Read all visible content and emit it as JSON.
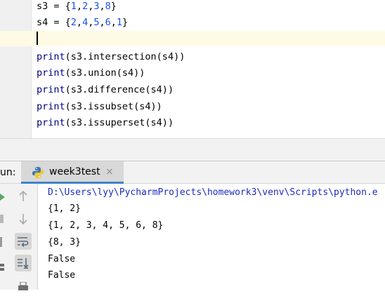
{
  "editor": {
    "lines": {
      "l1": {
        "a": "s3 = {",
        "n1": "1",
        "c1": ",",
        "n2": "2",
        "c2": ",",
        "n3": "3",
        "c3": ",",
        "n4": "8",
        "b": "}"
      },
      "l2": {
        "a": "s4 = {",
        "n1": "2",
        "c1": ",",
        "n2": "4",
        "c2": ",",
        "n3": "5",
        "c3": ",",
        "n4": "6",
        "c4": ",",
        "n5": "1",
        "b": "}"
      },
      "l4": {
        "fn": "print",
        "rest": "(s3.intersection(s4))"
      },
      "l5": {
        "fn": "print",
        "rest": "(s3.union(s4))"
      },
      "l6": {
        "fn": "print",
        "rest": "(s3.difference(s4))"
      },
      "l7": {
        "fn": "print",
        "rest": "(s3.issubset(s4))"
      },
      "l8": {
        "fn": "print",
        "rest": "(s3.issuperset(s4))"
      }
    }
  },
  "run_panel": {
    "label": "un:",
    "tab_label": "week3test",
    "tab_close": "×",
    "output": [
      "D:\\Users\\lyy\\PycharmProjects\\homework3\\venv\\Scripts\\python.e",
      "{1, 2}",
      "{1, 2, 3, 4, 5, 6, 8}",
      "{8, 3}",
      "False",
      "False"
    ]
  },
  "icons": {
    "tab": "python-icon",
    "toolbar": [
      "run-icon",
      "up-arrow-icon",
      "down-arrow-icon",
      "soft-wrap-icon",
      "scroll-to-end-icon",
      "print-icon"
    ]
  },
  "colors": {
    "number": "#1750eb",
    "function": "#000080",
    "path": "#1d2cc1",
    "caret_line": "#fffae3",
    "tab_underline": "#4083c9"
  }
}
